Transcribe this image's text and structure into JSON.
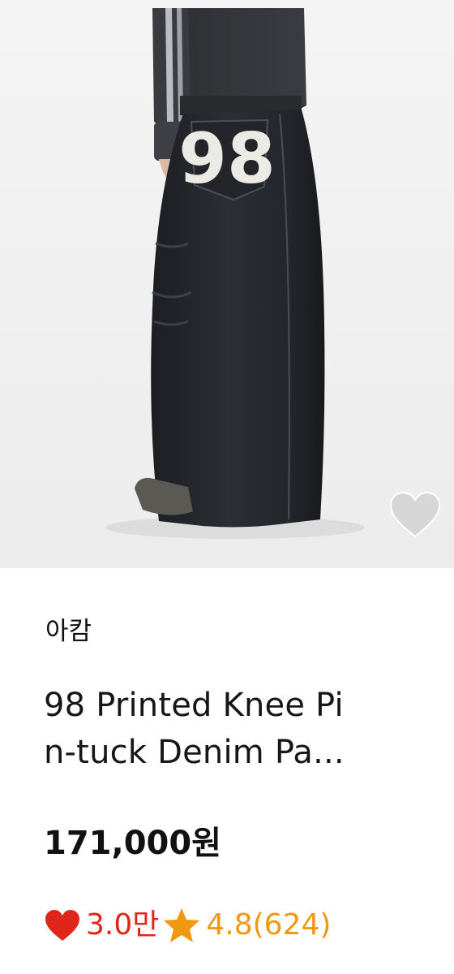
{
  "product": {
    "brand": "아캄",
    "title_line1": "98 Printed Knee Pi",
    "title_line2": "n-tuck Denim Pa...",
    "price": "171,000원",
    "image_print": "98",
    "likes": "3.0만",
    "rating": "4.8(624)"
  },
  "icons": {
    "wishlist": "heart-outline-icon",
    "likes": "heart-icon",
    "rating": "star-icon"
  },
  "colors": {
    "like_red": "#e0261b",
    "rating_orange": "#f19813",
    "wishlist_gray": "#d6d6d6"
  }
}
